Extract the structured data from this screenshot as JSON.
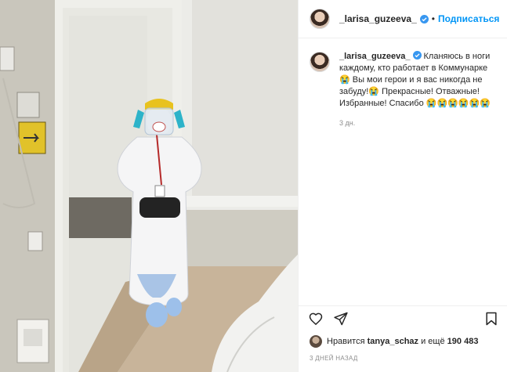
{
  "post": {
    "username": "_larisa_guzeeva_",
    "separator": "•",
    "follow_label": "Подписаться",
    "caption_text": "Кланяюсь в ноги каждому, кто работает в Коммунарке 😭 Вы мои герои и я вас никогда не забуду!😭 Прекрасные! Отважные! Избранные! Спасибо 😭😭😭😭😭😭",
    "caption_time": "3 дн.",
    "likes_prefix": "Нравится ",
    "likes_user": "tanya_schaz",
    "likes_mid": " и ещё ",
    "likes_count": "190 483",
    "date": "3 ДНЕЙ НАЗАД"
  },
  "icons": {
    "verified": "verified-badge-icon",
    "more": "more-options-icon",
    "like": "heart-icon",
    "share": "paper-plane-icon",
    "save": "bookmark-icon"
  },
  "colors": {
    "accent": "#0095f6",
    "text": "#262626",
    "secondary": "#8e8e8e",
    "border": "#efefef"
  }
}
